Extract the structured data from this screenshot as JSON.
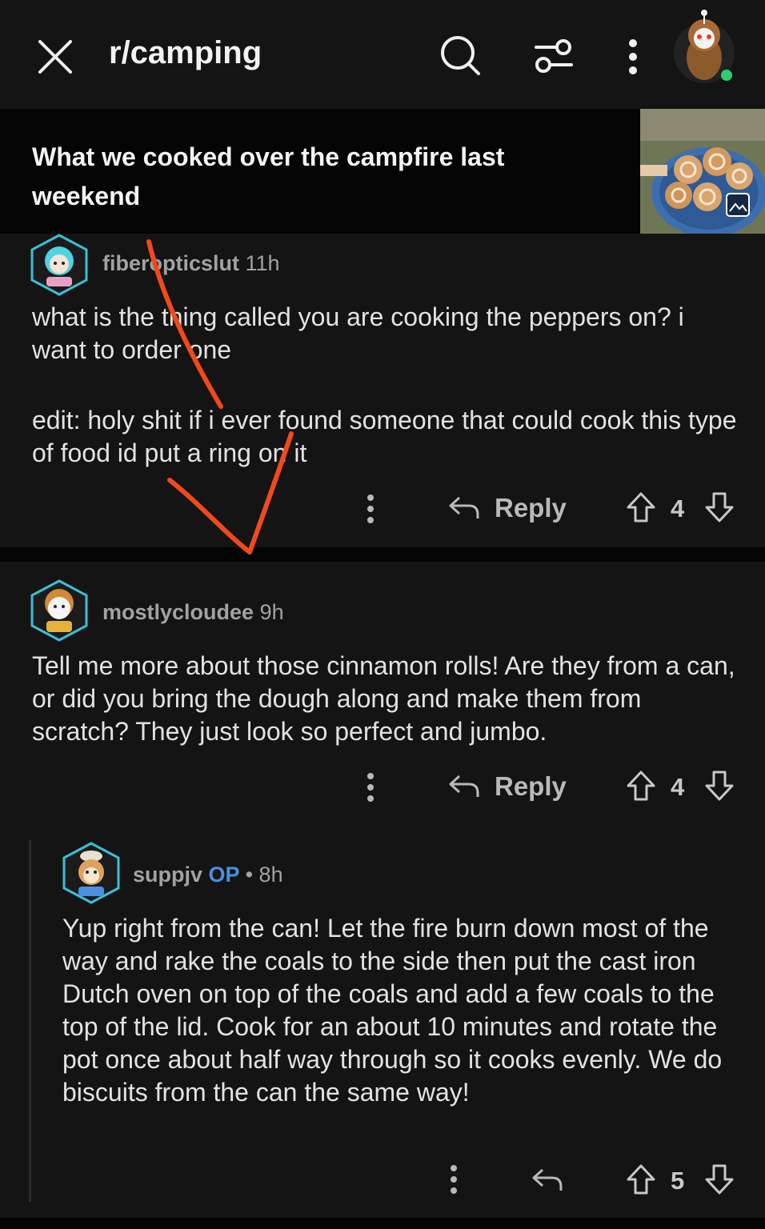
{
  "header": {
    "subreddit": "r/camping",
    "icons": {
      "close": "close-icon",
      "search": "search-icon",
      "filter": "filter-sliders-icon",
      "more": "more-vertical-icon",
      "profile": "profile-avatar"
    },
    "online_status_color": "#2ecc71"
  },
  "post": {
    "title": "What we cooked over the campfire last weekend",
    "thumbnail_icon": "image-gallery-icon"
  },
  "comments": [
    {
      "username": "fiberopticslut",
      "age": "11h",
      "body_paragraphs": [
        "what is the thing called you are cooking the peppers on? i want to order one",
        "edit: holy shit if i ever found someone that could cook this type of food id put a ring on it"
      ],
      "reply_label": "Reply",
      "votes": "4"
    },
    {
      "username": "mostlycloudee",
      "age": "9h",
      "body": "Tell me more about those cinnamon rolls! Are they from a can, or did you bring the dough along and make them from scratch? They just look so perfect and jumbo.",
      "reply_label": "Reply",
      "votes": "4"
    },
    {
      "username": "suppjv",
      "op_badge": "OP",
      "separator": "•",
      "age": "8h",
      "body": "Yup right from the can! Let the fire burn down most of the way and rake the coals to the side then put the cast iron Dutch oven on top of the coals and add a few coals to the top of the lid. Cook for an about 10 minutes and rotate the pot once about half way through so it cooks evenly. We do biscuits from the can the same way!",
      "votes": "5"
    }
  ],
  "colors": {
    "accent_op": "#4a90e2",
    "annotation": "#f04a1c"
  }
}
